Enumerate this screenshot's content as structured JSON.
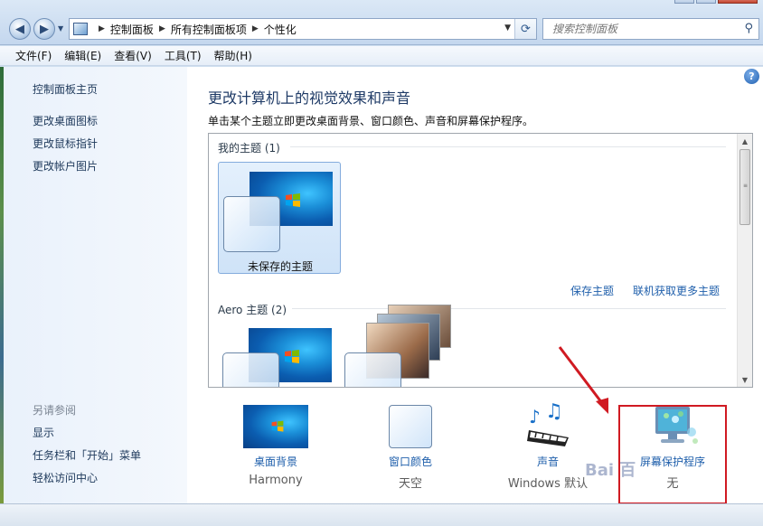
{
  "address_bar": {
    "crumbs": [
      "控制面板",
      "所有控制面板项",
      "个性化"
    ],
    "search_placeholder": "搜索控制面板"
  },
  "menu": [
    "文件(F)",
    "编辑(E)",
    "查看(V)",
    "工具(T)",
    "帮助(H)"
  ],
  "sidebar": {
    "home": "控制面板主页",
    "links": [
      "更改桌面图标",
      "更改鼠标指针",
      "更改帐户图片"
    ],
    "see_also_label": "另请参阅",
    "see_also": [
      "显示",
      "任务栏和「开始」菜单",
      "轻松访问中心"
    ]
  },
  "main": {
    "title": "更改计算机上的视觉效果和声音",
    "subtitle": "单击某个主题立即更改桌面背景、窗口颜色、声音和屏幕保护程序。",
    "help_icon": "?",
    "my_themes_header": "我的主题 (1)",
    "unsaved_theme_label": "未保存的主题",
    "save_theme_link": "保存主题",
    "get_more_link": "联机获取更多主题",
    "aero_header": "Aero 主题 (2)"
  },
  "bottom": [
    {
      "label": "桌面背景",
      "value": "Harmony",
      "icon": "wallpaper-icon"
    },
    {
      "label": "窗口颜色",
      "value": "天空",
      "icon": "window-color-icon"
    },
    {
      "label": "声音",
      "value": "Windows 默认",
      "icon": "sound-icon"
    },
    {
      "label": "屏幕保护程序",
      "value": "无",
      "icon": "screensaver-icon"
    }
  ],
  "watermark": "Bai 百",
  "colors": {
    "link": "#1f5fab",
    "highlight_border": "#d01a22",
    "arrow": "#d01a22"
  }
}
